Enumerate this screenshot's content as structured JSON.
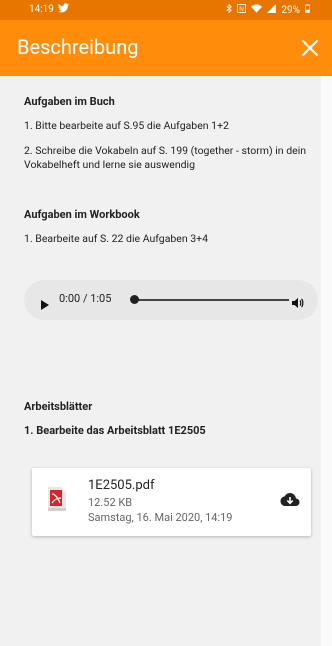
{
  "status": {
    "time": "14:19",
    "battery": "29%"
  },
  "header": {
    "title": "Beschreibung"
  },
  "sections": {
    "buch_title": "Aufgaben im Buch",
    "buch_item1": "1. Bitte bearbeite auf S.95 die Aufgaben 1+2",
    "buch_item2": "2. Schreibe die Vokabeln auf S. 199 (together - storm) in dein Vokabelheft und lerne sie auswendig",
    "workbook_title": "Aufgaben im Workbook",
    "workbook_item1": "1. Bearbeite auf S. 22 die Aufgaben 3+4",
    "arbeitsblaetter_title": "Arbeitsblätter",
    "arbeitsblaetter_item1": "1. Bearbeite das Arbeitsblatt 1E2505"
  },
  "audio": {
    "time": "0:00 / 1:05",
    "progress": 0
  },
  "file": {
    "name": "1E2505.pdf",
    "size": "12.52 KB",
    "date": "Samstag, 16. Mai 2020, 14:19"
  },
  "colors": {
    "header": "#ff8c0a",
    "status_bar": "#e67600"
  }
}
